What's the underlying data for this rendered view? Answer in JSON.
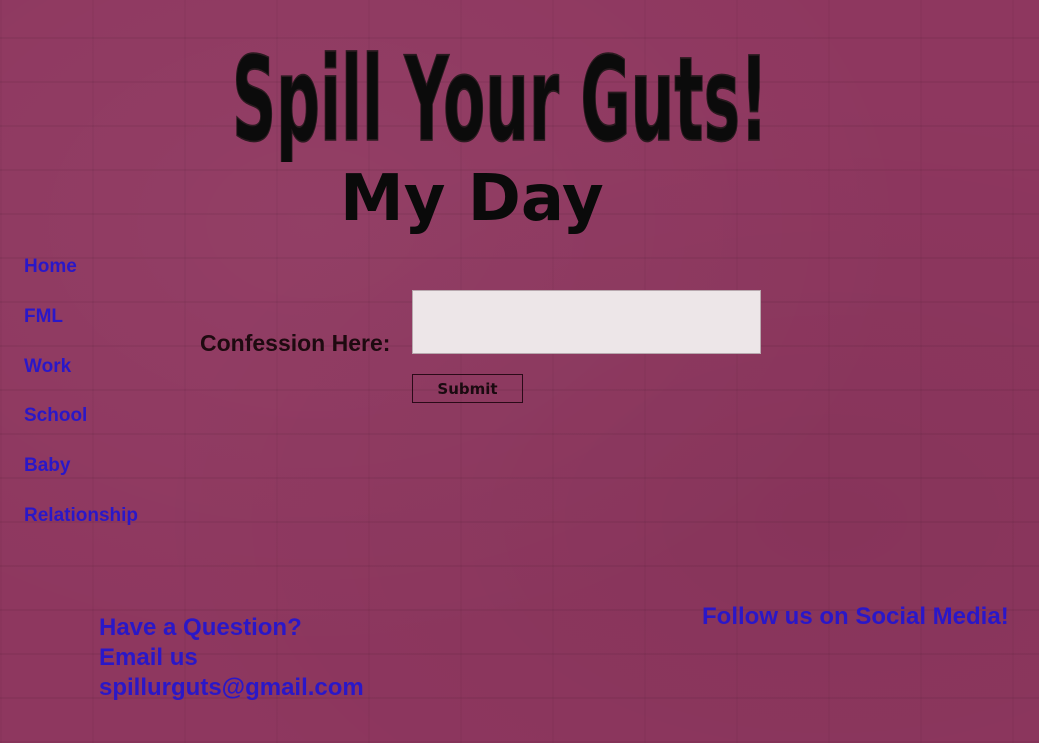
{
  "header": {
    "logo_text": "Spill Your Guts!",
    "page_title": "My Day"
  },
  "nav": {
    "items": [
      {
        "label": "Home"
      },
      {
        "label": "FML"
      },
      {
        "label": "Work"
      },
      {
        "label": "School"
      },
      {
        "label": "Baby"
      },
      {
        "label": "Relationship"
      }
    ]
  },
  "form": {
    "label": "Confession Here:",
    "input_value": "",
    "submit_label": "Submit"
  },
  "footer": {
    "question": "Have a Question?",
    "email_prompt": "Email us",
    "email": "spillurguts@gmail.com",
    "social": "Follow us on Social Media!"
  },
  "colors": {
    "background": "#8e375f",
    "link": "#2a17c8",
    "logo_fill": "#0b0b0b",
    "input_fill": "#ede6e8"
  }
}
